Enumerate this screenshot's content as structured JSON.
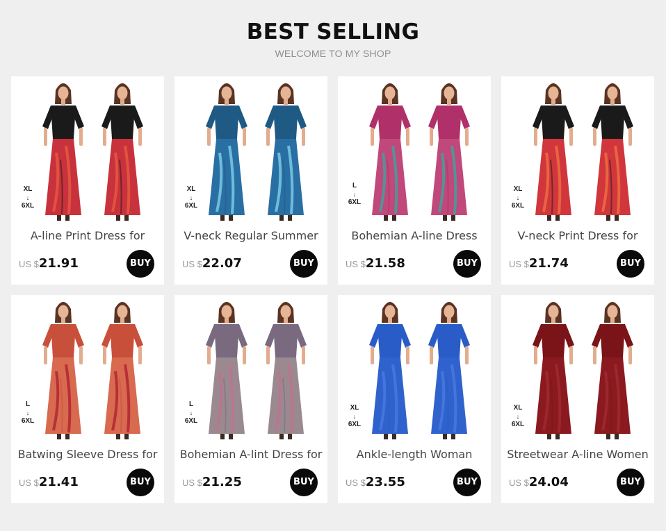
{
  "header": {
    "title": "BEST SELLING",
    "subtitle": "WELCOME TO MY SHOP"
  },
  "buy_label": "BUY",
  "products": [
    {
      "name": "A-line Print Dress for",
      "currency": "US $",
      "price": "21.91",
      "size_from": "XL",
      "size_arrow": "↓",
      "size_to": "6XL",
      "icon": "dress-photo",
      "colors": {
        "top": "#1a1a1a",
        "skirt": "#c8323c",
        "accent": "#e85a40"
      }
    },
    {
      "name": "V-neck Regular Summer",
      "currency": "US $",
      "price": "22.07",
      "size_from": "XL",
      "size_arrow": "↓",
      "size_to": "6XL",
      "icon": "dress-photo",
      "colors": {
        "top": "#1f5a85",
        "skirt": "#2a6fa3",
        "accent": "#7fd0e8"
      }
    },
    {
      "name": "Bohemian A-line Dress",
      "currency": "US $",
      "price": "21.58",
      "size_from": "L",
      "size_arrow": "↓",
      "size_to": "6XL",
      "icon": "dress-photo",
      "colors": {
        "top": "#b0306a",
        "skirt": "#c0487a",
        "accent": "#3aa5a0"
      }
    },
    {
      "name": "V-neck Print Dress for",
      "currency": "US $",
      "price": "21.74",
      "size_from": "XL",
      "size_arrow": "↓",
      "size_to": "6XL",
      "icon": "dress-photo",
      "colors": {
        "top": "#1a1a1a",
        "skirt": "#d0363c",
        "accent": "#f07040"
      }
    },
    {
      "name": "Batwing Sleeve Dress for",
      "currency": "US $",
      "price": "21.41",
      "size_from": "L",
      "size_arrow": "↓",
      "size_to": "6XL",
      "icon": "dress-photo",
      "colors": {
        "top": "#c8503a",
        "skirt": "#d86a50",
        "accent": "#b02030"
      }
    },
    {
      "name": "Bohemian A-lint Dress for",
      "currency": "US $",
      "price": "21.25",
      "size_from": "L",
      "size_arrow": "↓",
      "size_to": "6XL",
      "icon": "dress-photo",
      "colors": {
        "top": "#7a6a80",
        "skirt": "#9a8a90",
        "accent": "#c07090"
      }
    },
    {
      "name": "Ankle-length Woman",
      "currency": "US $",
      "price": "23.55",
      "size_from": "XL",
      "size_arrow": "↓",
      "size_to": "6XL",
      "icon": "dress-photo",
      "colors": {
        "top": "#2a5cc8",
        "skirt": "#2f62cc",
        "accent": "#4a7ae0"
      }
    },
    {
      "name": "Streetwear A-line Women",
      "currency": "US $",
      "price": "24.04",
      "size_from": "XL",
      "size_arrow": "↓",
      "size_to": "6XL",
      "icon": "dress-photo",
      "colors": {
        "top": "#7a1418",
        "skirt": "#8a1a20",
        "accent": "#a02a30"
      }
    }
  ]
}
